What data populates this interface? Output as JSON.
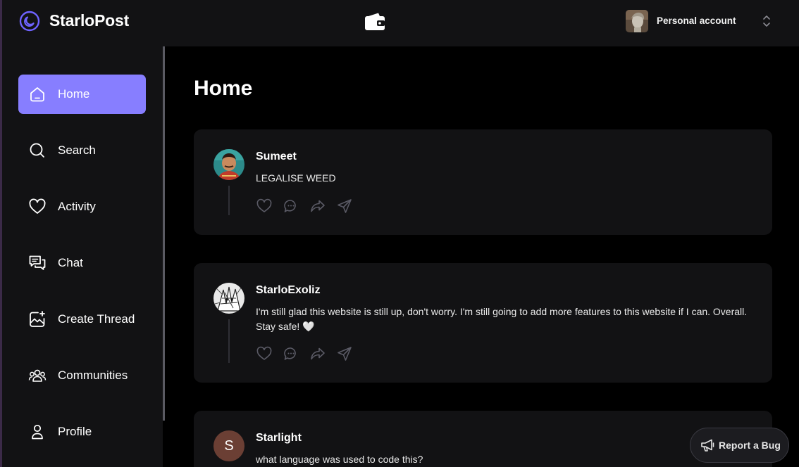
{
  "app": {
    "name": "StarloPost"
  },
  "header": {
    "account_label": "Personal account",
    "icons": {
      "logo": "starlo-logo-icon",
      "wallet": "wallet-icon",
      "switcher": "chevron-up-down-icon"
    }
  },
  "sidebar": {
    "items": [
      {
        "label": "Home",
        "icon": "home-icon",
        "active": true
      },
      {
        "label": "Search",
        "icon": "search-icon",
        "active": false
      },
      {
        "label": "Activity",
        "icon": "heart-icon",
        "active": false
      },
      {
        "label": "Chat",
        "icon": "chat-icon",
        "active": false
      },
      {
        "label": "Create Thread",
        "icon": "create-thread-icon",
        "active": false
      },
      {
        "label": "Communities",
        "icon": "communities-icon",
        "active": false
      },
      {
        "label": "Profile",
        "icon": "profile-icon",
        "active": false
      }
    ]
  },
  "main": {
    "title": "Home",
    "posts": [
      {
        "author": "Sumeet",
        "text": "LEGALISE WEED"
      },
      {
        "author": "StarloExoliz",
        "text": "I'm still glad this website is still up, don't worry. I'm still going to add more features to this website if I can. Overall. Stay safe! 🤍"
      },
      {
        "author": "Starlight",
        "text": "what language was used to code this?",
        "avatar_letter": "S"
      }
    ]
  },
  "report_bug": {
    "label": "Report a Bug",
    "icon": "megaphone-icon"
  },
  "colors": {
    "accent": "#877eff",
    "panel": "#121214",
    "background": "#000000"
  }
}
